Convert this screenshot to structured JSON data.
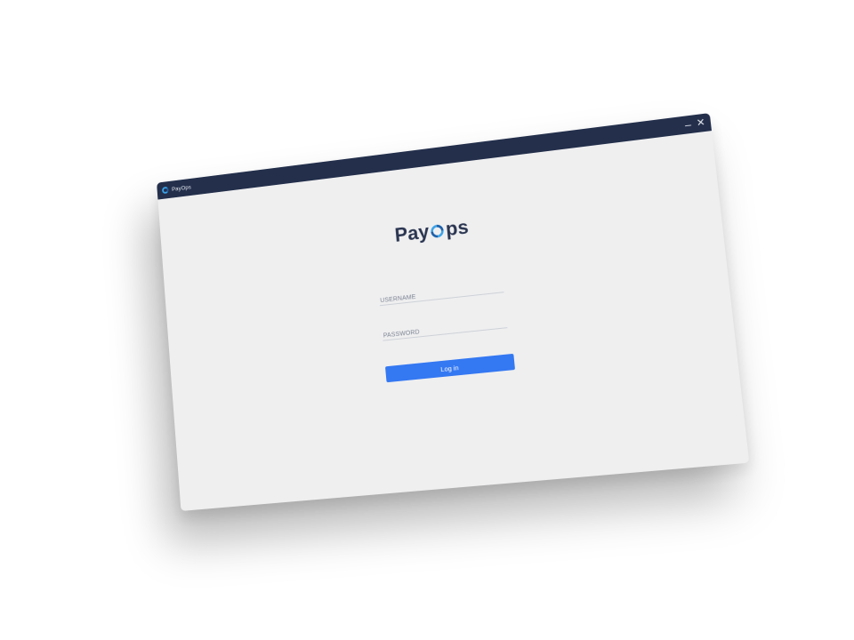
{
  "window": {
    "title": "PayOps",
    "minimize_symbol": "–",
    "close_symbol": "✕"
  },
  "logo": {
    "prefix": "Pay",
    "suffix": "ps"
  },
  "form": {
    "username_placeholder": "USERNAME",
    "username_value": "",
    "password_placeholder": "PASSWORD",
    "password_value": "",
    "login_label": "Log in"
  },
  "colors": {
    "titlebar": "#232f4b",
    "background": "#efeff0",
    "button": "#3478f2",
    "logo_text": "#2a3550",
    "logo_ring_light": "#3ba3e8",
    "logo_ring_dark": "#1e5fa8"
  },
  "icons": {
    "app": "payops-logo-icon",
    "minimize": "minimize-icon",
    "close": "close-icon"
  }
}
